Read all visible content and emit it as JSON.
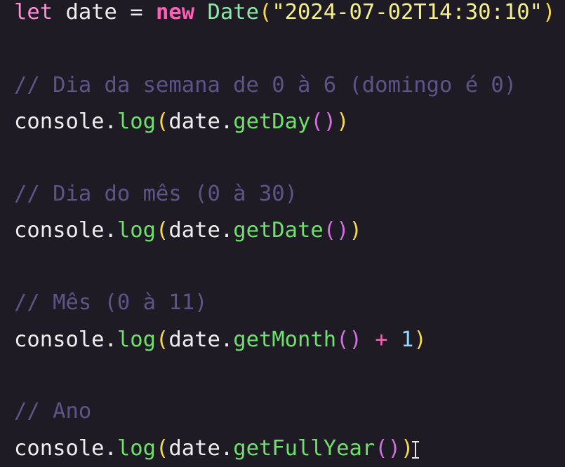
{
  "code": {
    "line1": {
      "kw_let": "let",
      "var_name": " date ",
      "eq": "= ",
      "kw_new": "new",
      "space": " ",
      "class_name": "Date",
      "open_paren": "(",
      "string": "\"2024-07-02T14:30:10\"",
      "close_paren": ")"
    },
    "line2": {
      "comment": "// Dia da semana de 0 à 6 (domingo é 0)"
    },
    "line3": {
      "obj": "console.",
      "method": "log",
      "open_paren": "(",
      "target": "date.",
      "call": "getDay",
      "call_parens": "()",
      "close_paren": ")"
    },
    "line4": {
      "comment": "// Dia do mês (0 à 30)"
    },
    "line5": {
      "obj": "console.",
      "method": "log",
      "open_paren": "(",
      "target": "date.",
      "call": "getDate",
      "call_parens": "()",
      "close_paren": ")"
    },
    "line6": {
      "comment": "// Mês (0 à 11)"
    },
    "line7": {
      "obj": "console.",
      "method": "log",
      "open_paren": "(",
      "target": "date.",
      "call": "getMonth",
      "call_parens": "()",
      "plus": " + ",
      "number": "1",
      "close_paren": ")"
    },
    "line8": {
      "comment": "// Ano"
    },
    "line9": {
      "obj": "console.",
      "method": "log",
      "open_paren": "(",
      "target": "date.",
      "call": "getFullYear",
      "call_parens": "()",
      "close_paren": ")"
    }
  },
  "colors": {
    "background": "#1f1b24",
    "keyword": "#ff5fb7",
    "function": "#6ee06b",
    "string": "#f3f08a",
    "comment": "#5e5488",
    "number": "#8fd7ff"
  },
  "cursor": {
    "type": "text-ibeam-cursor"
  }
}
